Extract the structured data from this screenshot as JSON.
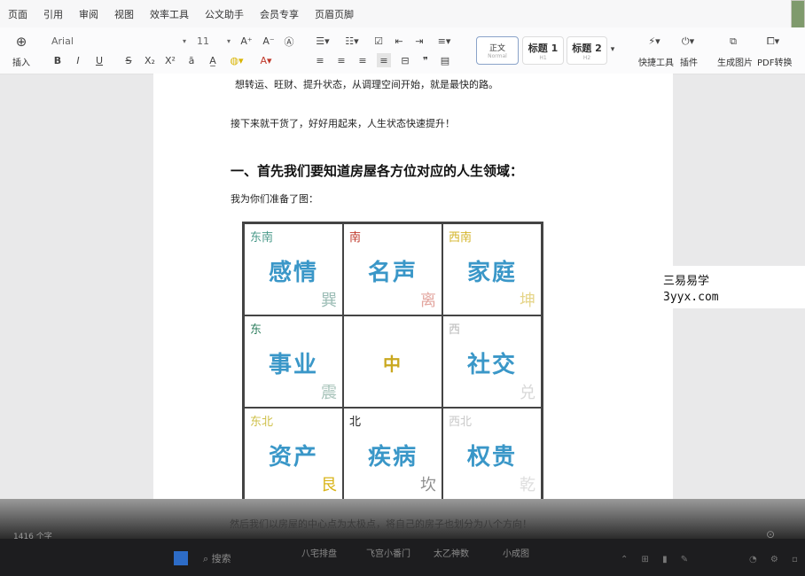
{
  "menubar": {
    "items": [
      "页面",
      "引用",
      "审阅",
      "视图",
      "效率工具",
      "公文助手",
      "会员专享",
      "页眉页脚"
    ]
  },
  "toolbar": {
    "insert_label": "插入",
    "font_name": "Arial",
    "font_size": "11",
    "styles": [
      {
        "name": "正文",
        "sub": "Normal"
      },
      {
        "name": "标题 1",
        "sub": "H1"
      },
      {
        "name": "标题 2",
        "sub": "H2"
      }
    ],
    "quick_tools_label": "快捷工具",
    "plugins_label": "插件",
    "gen_image_label": "生成图片",
    "pdf_label": "PDF转换",
    "format_glyphs": [
      "B",
      "I",
      "U",
      "S",
      "X₂",
      "X²"
    ]
  },
  "document": {
    "para1": "想转运、旺财、提升状态，从调理空间开始，就是最快的路。",
    "para2": "接下来就干货了，好好用起来，人生状态快速提升！",
    "heading": "一、首先我们要知道房屋各方位对应的人生领域：",
    "para3": "我为你们准备了图：",
    "bottom_partial": "然后我们以房屋的中心点为太极点，将自己的房子也划分为八个方向！",
    "grid": [
      {
        "direction": "东南",
        "domain": "感情",
        "trigram": "巽",
        "dir_color": "#4a9a8a",
        "tri_color": "#9bbcb5"
      },
      {
        "direction": "南",
        "domain": "名声",
        "trigram": "离",
        "dir_color": "#c0392b",
        "tri_color": "#e3a7a0"
      },
      {
        "direction": "西南",
        "domain": "家庭",
        "trigram": "坤",
        "dir_color": "#d4b52a",
        "tri_color": "#e6d58a"
      },
      {
        "direction": "东",
        "domain": "事业",
        "trigram": "震",
        "dir_color": "#2f7f5f",
        "tri_color": "#a9c4bb"
      },
      {
        "direction": "",
        "domain": "中",
        "trigram": "",
        "dir_color": "#c9a820",
        "tri_color": "#c9a820"
      },
      {
        "direction": "西",
        "domain": "社交",
        "trigram": "兑",
        "dir_color": "#b8b8b8",
        "tri_color": "#d8d8d8"
      },
      {
        "direction": "东北",
        "domain": "资产",
        "trigram": "艮",
        "dir_color": "#cfc04a",
        "tri_color": "#d9b41a"
      },
      {
        "direction": "北",
        "domain": "疾病",
        "trigram": "坎",
        "dir_color": "#222222",
        "tri_color": "#8f8f8f"
      },
      {
        "direction": "西北",
        "domain": "权贵",
        "trigram": "乾",
        "dir_color": "#c8c8c8",
        "tri_color": "#dedede"
      }
    ]
  },
  "watermark": {
    "line1": "三易易学",
    "line2": "3yyx.com"
  },
  "status": {
    "word_count": "1416 个字"
  },
  "taskbar": {
    "search_label": "搜索",
    "items": [
      "八宅排盘",
      "飞宫小番门",
      "太乙神数",
      "小成图"
    ]
  }
}
